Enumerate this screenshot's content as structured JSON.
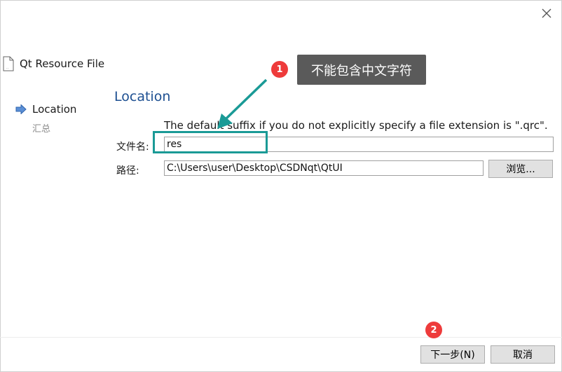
{
  "wizard": {
    "title": "Qt Resource File",
    "file_icon": "document-icon",
    "close_icon": "close-icon",
    "steps": [
      {
        "label": "Location",
        "state": "current"
      },
      {
        "label": "汇总",
        "state": "pending"
      }
    ]
  },
  "page": {
    "title": "Location",
    "hint": "The default suffix if you do not explicitly specify a file extension is \".qrc\"."
  },
  "form": {
    "name_label": "文件名:",
    "name_value": "res",
    "path_label": "路径:",
    "path_value": "C:\\Users\\user\\Desktop\\CSDNqt\\QtUI",
    "browse_label": "浏览..."
  },
  "buttons": {
    "next_label": "下一步(N)",
    "cancel_label": "取消"
  },
  "annotations": {
    "badge_1": "1",
    "note_1": "不能包含中文字符",
    "badge_2": "2",
    "box_color": "#1a9a96",
    "badge_color": "#ee3b3b"
  }
}
